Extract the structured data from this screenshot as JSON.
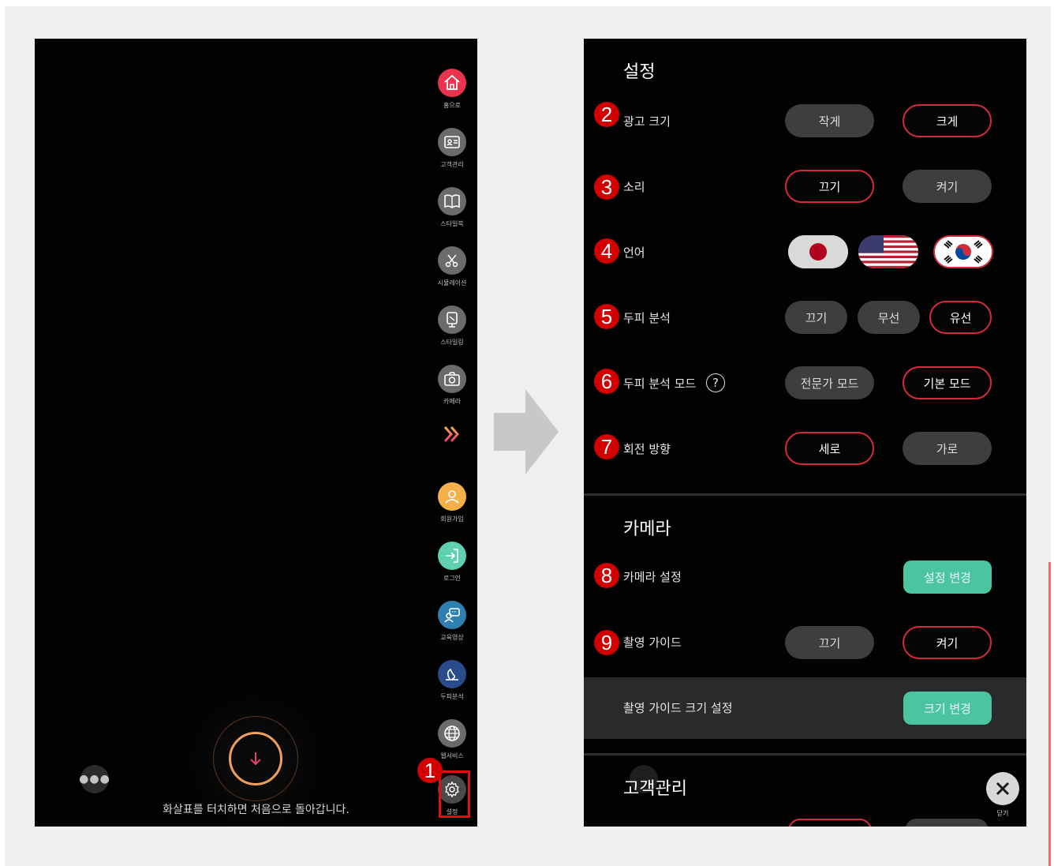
{
  "left_screen": {
    "menu": [
      {
        "label": "홈으로",
        "icon": "home-icon",
        "color": "#e8344e"
      },
      {
        "label": "고객관리",
        "icon": "id-card-icon",
        "color": "#6b6b6b"
      },
      {
        "label": "스타일북",
        "icon": "book-icon",
        "color": "#6b6b6b"
      },
      {
        "label": "시뮬레이션",
        "icon": "scissors-icon",
        "color": "#6b6b6b"
      },
      {
        "label": "스타일링",
        "icon": "mirror-icon",
        "color": "#6b6b6b"
      },
      {
        "label": "카메라",
        "icon": "camera-icon",
        "color": "#6b6b6b"
      }
    ],
    "menu_lower": [
      {
        "label": "회원가입",
        "icon": "user-icon",
        "color": "#f6b04a"
      },
      {
        "label": "로그인",
        "icon": "login-icon",
        "color": "#5fd0b0"
      },
      {
        "label": "교육영상",
        "icon": "video-chat-icon",
        "color": "#2f7fb0"
      },
      {
        "label": "두피분석",
        "icon": "scalp-icon",
        "color": "#2a4c8c"
      },
      {
        "label": "웹서비스",
        "icon": "globe-icon",
        "color": "#6b6b6b"
      },
      {
        "label": "설정",
        "icon": "gear-icon",
        "color": "#6b6b6b"
      }
    ],
    "hint": "화살표를 터치하면 처음으로 돌아갑니다.",
    "badge": "1"
  },
  "right_screen": {
    "settings_title": "설정",
    "rows": [
      {
        "badge": "2",
        "label": "광고 크기",
        "options": [
          "작게",
          "크게"
        ],
        "selected": 1
      },
      {
        "badge": "3",
        "label": "소리",
        "options": [
          "끄기",
          "켜기"
        ],
        "selected": 0
      },
      {
        "badge": "4",
        "label": "언어",
        "flags": [
          "japan-flag",
          "usa-flag",
          "korea-flag"
        ],
        "selected": 2
      },
      {
        "badge": "5",
        "label": "두피 분석",
        "options": [
          "끄기",
          "무선",
          "유선"
        ],
        "selected": 2
      },
      {
        "badge": "6",
        "label": "두피 분석 모드",
        "help": "?",
        "options": [
          "전문가 모드",
          "기본 모드"
        ],
        "selected": 1
      },
      {
        "badge": "7",
        "label": "회전 방향",
        "options": [
          "세로",
          "가로"
        ],
        "selected": 0
      }
    ],
    "camera_title": "카메라",
    "camera_rows": [
      {
        "badge": "8",
        "label": "카메라 설정",
        "button": "설정 변경"
      },
      {
        "badge": "9",
        "label": "촬영 가이드",
        "options": [
          "끄기",
          "켜기"
        ],
        "selected": 1
      },
      {
        "label": "촬영 가이드 크기 설정",
        "button": "크기 변경"
      }
    ],
    "customer_title": "고객관리",
    "close_label": "닫기"
  },
  "colors": {
    "accent_red": "#d32b3a",
    "teal": "#4cc4a2",
    "badge_red": "#d20000"
  }
}
